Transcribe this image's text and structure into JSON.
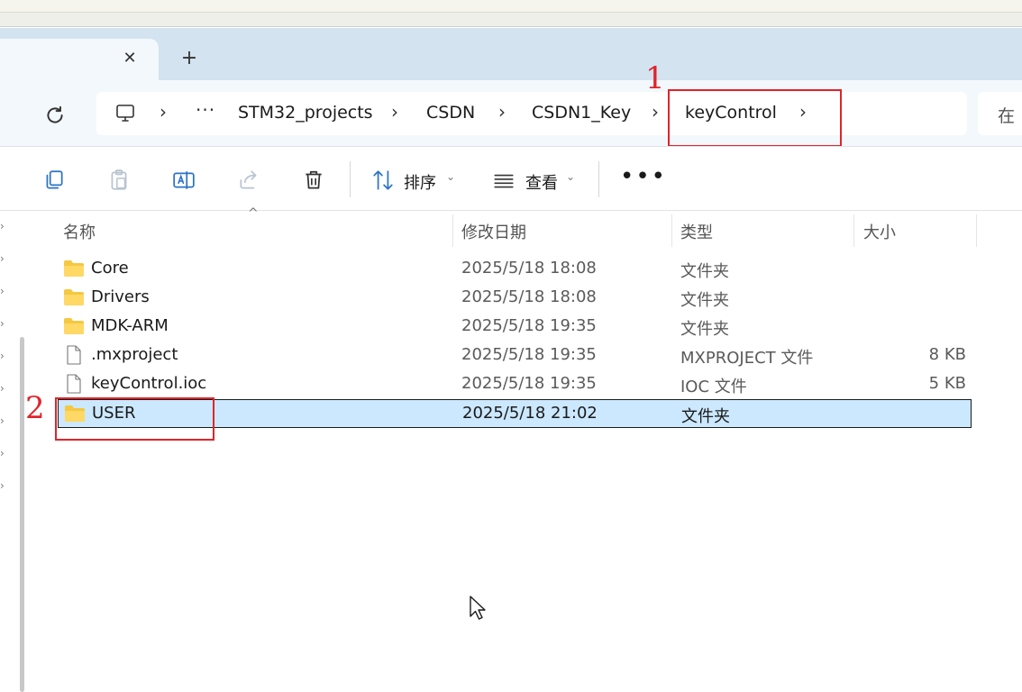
{
  "tabs": {
    "close_glyph": "✕",
    "new_tab_glyph": "+"
  },
  "address": {
    "breadcrumb": [
      "STM32_projects",
      "CSDN",
      "CSDN1_Key",
      "keyControl"
    ],
    "overflow": "···",
    "separator": "›",
    "search_placeholder": "在"
  },
  "annotations": {
    "label_1": "1",
    "label_2": "2",
    "color": "#e0242a"
  },
  "toolbar": {
    "sort_label": "排序",
    "view_label": "查看",
    "dropdown_glyph": "⌄",
    "more_glyph": "•••"
  },
  "columns": {
    "name": "名称",
    "date": "修改日期",
    "type": "类型",
    "size": "大小"
  },
  "files": [
    {
      "name": "Core",
      "date": "2025/5/18 18:08",
      "type": "文件夹",
      "size": "",
      "icon": "folder-icon"
    },
    {
      "name": "Drivers",
      "date": "2025/5/18 18:08",
      "type": "文件夹",
      "size": "",
      "icon": "folder-icon"
    },
    {
      "name": "MDK-ARM",
      "date": "2025/5/18 19:35",
      "type": "文件夹",
      "size": "",
      "icon": "folder-icon"
    },
    {
      "name": ".mxproject",
      "date": "2025/5/18 19:35",
      "type": "MXPROJECT 文件",
      "size": "8 KB",
      "icon": "file-icon"
    },
    {
      "name": "keyControl.ioc",
      "date": "2025/5/18 19:35",
      "type": "IOC 文件",
      "size": "5 KB",
      "icon": "file-icon"
    },
    {
      "name": "USER",
      "date": "2025/5/18 21:02",
      "type": "文件夹",
      "size": "",
      "icon": "folder-icon",
      "selected": true
    }
  ],
  "colors": {
    "accent": "#cce8ff",
    "tabbar": "#d3e3ef",
    "folder": "#f5c842"
  }
}
